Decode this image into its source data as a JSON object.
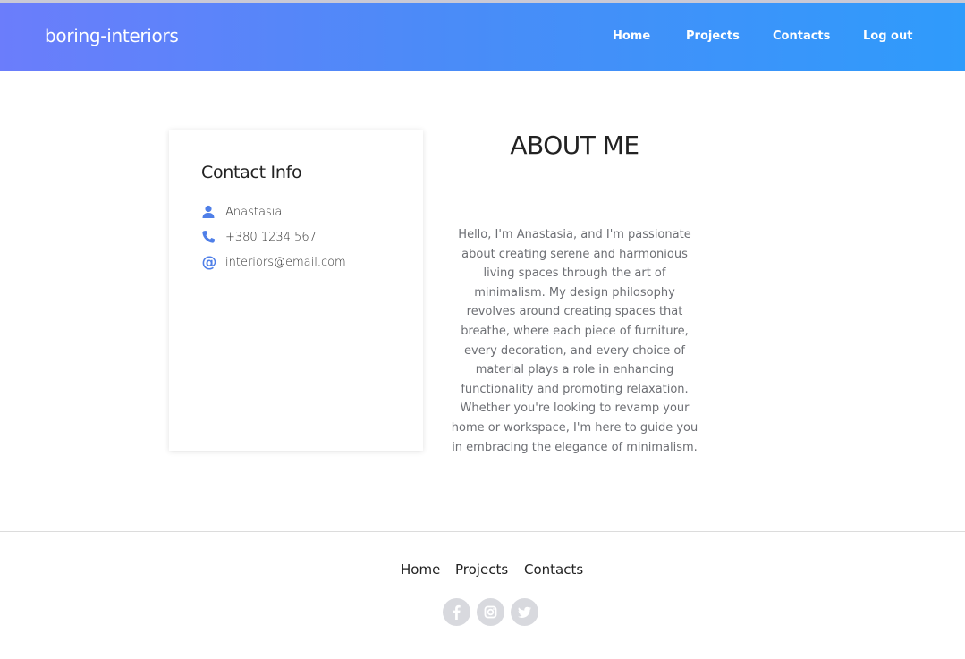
{
  "header": {
    "brand": "boring-interiors",
    "nav": [
      {
        "label": "Home"
      },
      {
        "label": "Projects"
      },
      {
        "label": "Contacts"
      },
      {
        "label": "Log out"
      }
    ]
  },
  "contact_card": {
    "title": "Contact Info",
    "items": [
      {
        "icon": "user-icon",
        "text": "Anastasia"
      },
      {
        "icon": "phone-icon",
        "text": "+380 1234 567"
      },
      {
        "icon": "at-icon",
        "text": "interiors@email.com"
      }
    ],
    "icon_color": "#4f7fe8"
  },
  "about": {
    "title": "ABOUT ME",
    "text": "Hello, I'm Anastasia, and I'm passionate about creating serene and harmonious living spaces through the art of minimalism. My design philosophy revolves around creating spaces that breathe, where each piece of furniture, every decoration, and every choice of material plays a role in enhancing functionality and promoting relaxation. Whether you're looking to revamp your home or workspace, I'm here to guide you in embracing the elegance of minimalism."
  },
  "footer": {
    "links": [
      {
        "label": "Home"
      },
      {
        "label": "Projects"
      },
      {
        "label": "Contacts"
      }
    ],
    "social": [
      "facebook-icon",
      "instagram-icon",
      "twitter-icon"
    ]
  },
  "colors": {
    "nav_gradient_start": "#6b7dfb",
    "nav_gradient_end": "#2f9bfb",
    "social_bg": "#d8d9de"
  }
}
